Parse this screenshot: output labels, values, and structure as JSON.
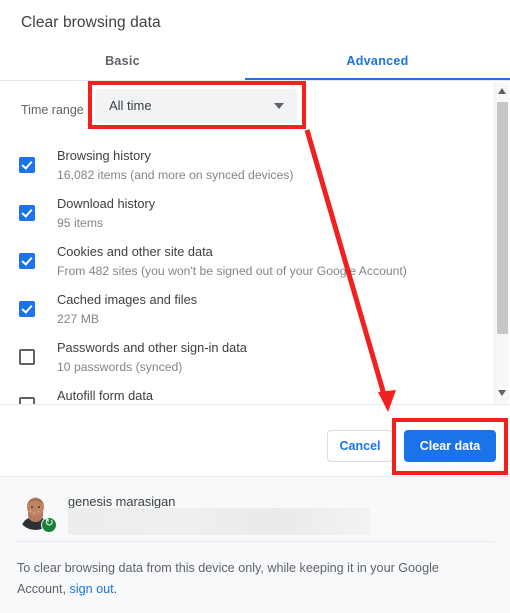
{
  "dialog": {
    "title": "Clear browsing data"
  },
  "tabs": [
    {
      "label": "Basic",
      "active": false
    },
    {
      "label": "Advanced",
      "active": true
    }
  ],
  "time_range": {
    "label": "Time range",
    "selected": "All time",
    "caret_icon": "chevron-down-icon"
  },
  "options": [
    {
      "title": "Browsing history",
      "sub": "16,082 items (and more on synced devices)",
      "checked": true
    },
    {
      "title": "Download history",
      "sub": "95 items",
      "checked": true
    },
    {
      "title": "Cookies and other site data",
      "sub": "From 482 sites (you won't be signed out of your Google Account)",
      "checked": true
    },
    {
      "title": "Cached images and files",
      "sub": "227 MB",
      "checked": true
    },
    {
      "title": "Passwords and other sign-in data",
      "sub": "10 passwords (synced)",
      "checked": false
    },
    {
      "title": "Autofill form data",
      "sub": "",
      "checked": false
    }
  ],
  "scrollbar": {
    "up_arrow_icon": "scroll-up-arrow-icon",
    "down_arrow_icon": "scroll-down-arrow-icon"
  },
  "buttons": {
    "cancel": "Cancel",
    "clear_data": "Clear data"
  },
  "account": {
    "name": "genesis marasigan",
    "email_redacted": true,
    "sync_badge_icon": "sync-icon",
    "avatar_icon": "user-avatar-photo"
  },
  "footer_note": {
    "before_link": "To clear browsing data from this device only, while keeping it in your Google Account, ",
    "link_text": "sign out",
    "after_link": "."
  },
  "annotations": {
    "highlight_time_range": "red-rectangle-around-time-range",
    "highlight_clear_data": "red-rectangle-around-clear-data",
    "arrow": "red-arrow-from-time-range-to-clear-data"
  },
  "colors": {
    "accent_blue": "#1a73e8",
    "annotation_red": "#f32020",
    "text_primary": "#3c4043",
    "text_secondary": "#5f6368",
    "text_muted": "#80868b",
    "footer_bg": "#f8f9fa",
    "dropdown_bg": "#f1f3f4",
    "sync_green": "#188038"
  }
}
